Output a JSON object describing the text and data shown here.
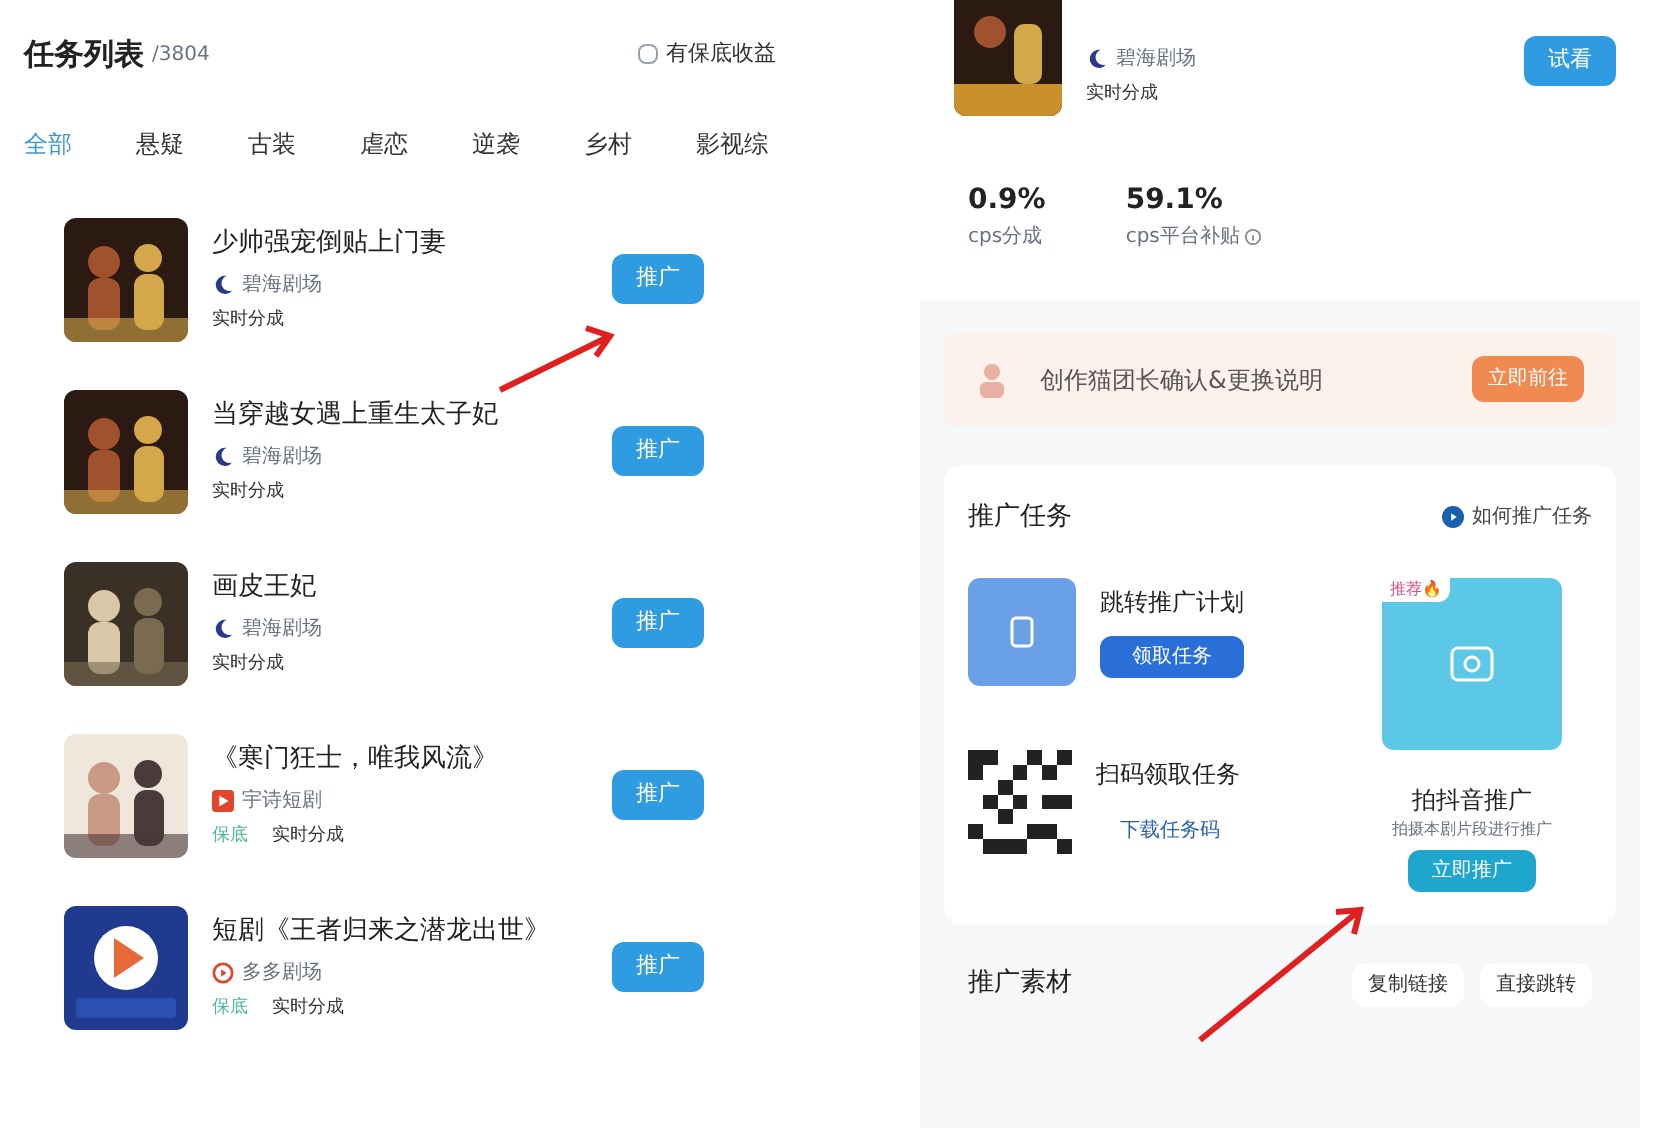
{
  "task_list": {
    "title": "任务列表",
    "count": "/3804",
    "filter": {
      "label": "有保底收益",
      "checked": false
    },
    "tabs": [
      {
        "label": "全部",
        "selected": true
      },
      {
        "label": "悬疑",
        "selected": false
      },
      {
        "label": "古装",
        "selected": false
      },
      {
        "label": "虐恋",
        "selected": false
      },
      {
        "label": "逆袭",
        "selected": false
      },
      {
        "label": "乡村",
        "selected": false
      },
      {
        "label": "影视综",
        "selected": false
      }
    ],
    "items": [
      {
        "title": "少帅强宠倒贴上门妻",
        "source": {
          "name": "碧海剧场",
          "kind": "moon"
        },
        "tags": [
          "实时分成"
        ],
        "button": "推广"
      },
      {
        "title": "当穿越女遇上重生太子妃",
        "source": {
          "name": "碧海剧场",
          "kind": "moon"
        },
        "tags": [
          "实时分成"
        ],
        "button": "推广"
      },
      {
        "title": "画皮王妃",
        "source": {
          "name": "碧海剧场",
          "kind": "moon"
        },
        "tags": [
          "实时分成"
        ],
        "button": "推广"
      },
      {
        "title": "《寒门狂士，唯我风流》",
        "source": {
          "name": "宇诗短剧",
          "kind": "play"
        },
        "tags": [
          "保底",
          "实时分成"
        ],
        "button": "推广"
      },
      {
        "title": "短剧《王者归来之潜龙出世》",
        "source": {
          "name": "多多剧场",
          "kind": "circle"
        },
        "tags": [
          "保底",
          "实时分成"
        ],
        "button": "推广"
      }
    ]
  },
  "detail": {
    "source": "碧海剧场",
    "tag": "实时分成",
    "preview_button": "试看",
    "stats": [
      {
        "value": "0.9%",
        "label": "cps分成",
        "info": false
      },
      {
        "value": "59.1%",
        "label": "cps平台补贴",
        "info": true
      }
    ],
    "banner": {
      "text": "创作猫团长确认&更换说明",
      "button": "立即前往"
    },
    "tasks_title": "推广任务",
    "howto_link": "如何推广任务",
    "plan": {
      "title": "跳转推广计划",
      "button": "领取任务"
    },
    "qr": {
      "title": "扫码领取任务",
      "link": "下载任务码"
    },
    "douyin": {
      "badge": "推荐🔥",
      "title": "拍抖音推广",
      "subtitle": "拍摄本剧片段进行推广",
      "button": "立即推广"
    },
    "materials_title": "推广素材",
    "material_buttons": [
      "复制链接",
      "直接跳转"
    ]
  }
}
